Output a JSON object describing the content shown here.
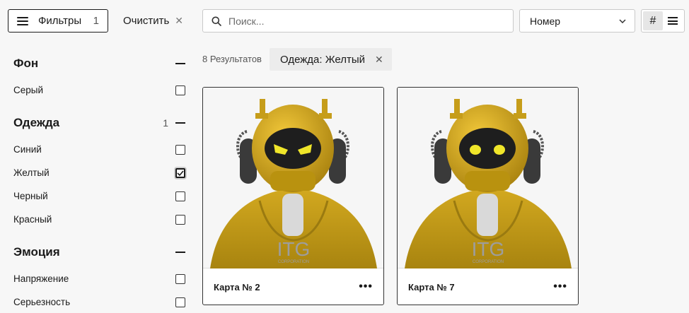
{
  "toolbar": {
    "filters_label": "Фильтры",
    "filters_count": "1",
    "clear_label": "Очистить",
    "search_placeholder": "Поиск...",
    "sort_value": "Номер",
    "view_grid_label": "#"
  },
  "sidebar": {
    "sections": [
      {
        "title": "Фон",
        "count": "",
        "options": [
          {
            "label": "Серый",
            "checked": false
          }
        ]
      },
      {
        "title": "Одежда",
        "count": "1",
        "options": [
          {
            "label": "Синий",
            "checked": false
          },
          {
            "label": "Желтый",
            "checked": true
          },
          {
            "label": "Черный",
            "checked": false
          },
          {
            "label": "Красный",
            "checked": false
          }
        ]
      },
      {
        "title": "Эмоция",
        "count": "",
        "options": [
          {
            "label": "Напряжение",
            "checked": false
          },
          {
            "label": "Серьезность",
            "checked": false
          }
        ]
      }
    ]
  },
  "results": {
    "count_text": "8 Результатов",
    "active_filter_chip": "Одежда: Желтый"
  },
  "cards": [
    {
      "title": "Карта № 2",
      "logo_text": "ITG",
      "logo_subtext": "CORPORATION",
      "emotion": "angry"
    },
    {
      "title": "Карта № 7",
      "logo_text": "ITG",
      "logo_subtext": "CORPORATION",
      "emotion": "neutral"
    }
  ],
  "colors": {
    "hoodie": "#c9a21a",
    "helmet": "#e0b220",
    "accent": "#1a1a1a"
  }
}
